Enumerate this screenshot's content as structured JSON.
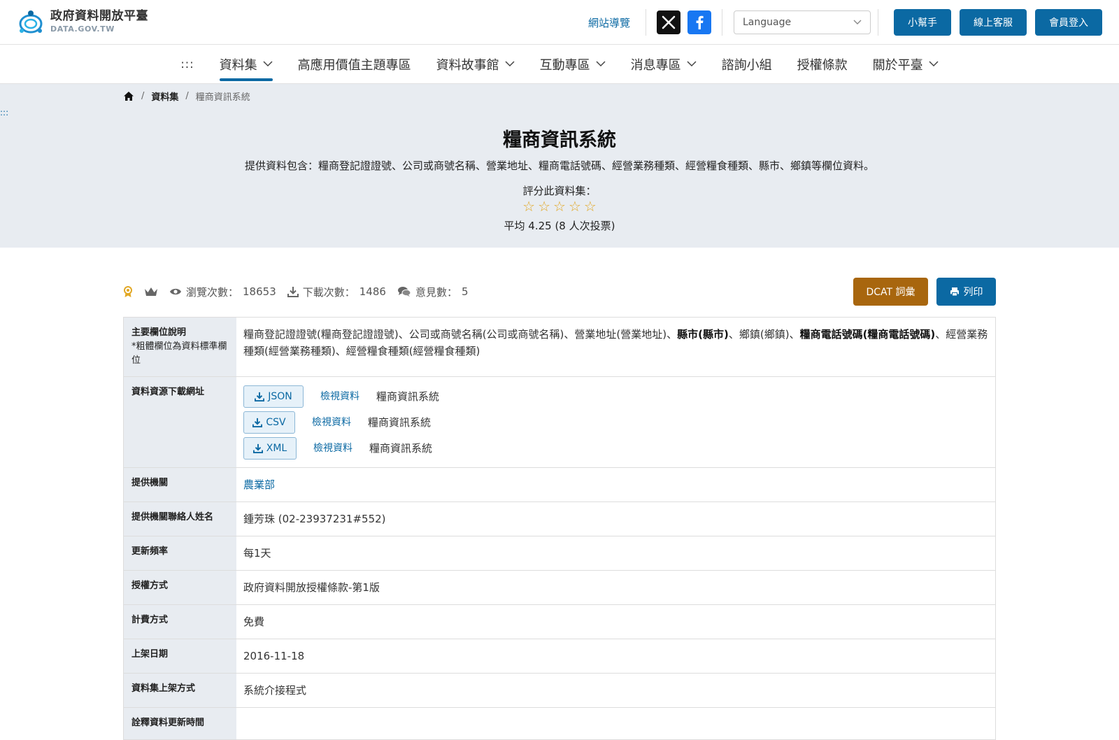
{
  "header": {
    "logo_cn": "政府資料開放平臺",
    "logo_en": "DATA.GOV.TW",
    "sitemap": "網站導覽",
    "language": "Language",
    "buttons": [
      "小幫手",
      "線上客服",
      "會員登入"
    ]
  },
  "nav": {
    "dots": ":::",
    "items": [
      {
        "label": "資料集",
        "dropdown": true
      },
      {
        "label": "高應用價值主題專區",
        "dropdown": false
      },
      {
        "label": "資料故事館",
        "dropdown": true
      },
      {
        "label": "互動專區",
        "dropdown": true
      },
      {
        "label": "消息專區",
        "dropdown": true
      },
      {
        "label": "諮詢小組",
        "dropdown": false
      },
      {
        "label": "授權條款",
        "dropdown": false
      },
      {
        "label": "關於平臺",
        "dropdown": true
      }
    ]
  },
  "breadcrumb": {
    "home_icon": "home-icon",
    "sep": "/",
    "section": "資料集",
    "current": "糧商資訊系統"
  },
  "side_dots": ":::",
  "dataset": {
    "title": "糧商資訊系統",
    "description": "提供資料包含：糧商登記證證號、公司或商號名稱、營業地址、糧商電話號碼、經營業務種類、經營糧食種類、縣市、鄉鎮等欄位資料。",
    "rate_label": "評分此資料集：",
    "stars": [
      "☆",
      "☆",
      "☆",
      "☆",
      "☆"
    ],
    "avg_text": "平均 4.25 (8 人次投票)"
  },
  "stats": {
    "views_label": "瀏覽次數：",
    "views": "18653",
    "downloads_label": "下載次數：",
    "downloads": "1486",
    "comments_label": "意見數：",
    "comments": "5",
    "dcat_button": "DCAT 詞彙",
    "print_button": "列印"
  },
  "info": {
    "fields": {
      "label": "主要欄位說明",
      "note": "*粗體欄位為資料標準欄位",
      "parts": [
        {
          "text": "糧商登記證證號(糧商登記證證號)、公司或商號名稱(公司或商號名稱)、營業地址(營業地址)、",
          "bold": false
        },
        {
          "text": "縣市(縣市)",
          "bold": true
        },
        {
          "text": "、鄉鎮(鄉鎮)、",
          "bold": false
        },
        {
          "text": "糧商電話號碼(糧商電話號碼)",
          "bold": true
        },
        {
          "text": "、經營業務種類(經營業務種類)、經營糧食種類(經營糧食種類)",
          "bold": false
        }
      ]
    },
    "resources": {
      "label": "資料資源下載網址",
      "items": [
        {
          "format": "JSON",
          "view": "檢視資料",
          "name": "糧商資訊系統"
        },
        {
          "format": "CSV",
          "view": "檢視資料",
          "name": "糧商資訊系統"
        },
        {
          "format": "XML",
          "view": "檢視資料",
          "name": "糧商資訊系統"
        }
      ]
    },
    "rows": [
      {
        "label": "提供機關",
        "value": "農業部",
        "link": true
      },
      {
        "label": "提供機關聯絡人姓名",
        "value": "鍾芳珠 (02-23937231#552)",
        "link": false
      },
      {
        "label": "更新頻率",
        "value": "每1天",
        "link": false
      },
      {
        "label": "授權方式",
        "value": "政府資料開放授權條款-第1版",
        "link": false
      },
      {
        "label": "計費方式",
        "value": "免費",
        "link": false
      },
      {
        "label": "上架日期",
        "value": "2016-11-18",
        "link": false
      },
      {
        "label": "資料集上架方式",
        "value": "系統介接程式",
        "link": false
      },
      {
        "label": "詮釋資料更新時間",
        "value": "",
        "link": false
      }
    ]
  }
}
